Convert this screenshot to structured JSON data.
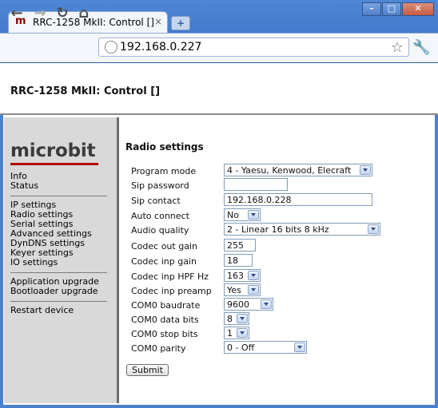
{
  "browser": {
    "tab_title": "RRC-1258 MkII: Control []",
    "tab_favicon": "m",
    "tab_close": "×",
    "new_tab": "+",
    "window_controls": {
      "min": "–",
      "max": "□",
      "close": "✕"
    },
    "nav": {
      "back": "←",
      "forward": "→",
      "reload": "↻",
      "home": "⌂"
    },
    "url": "192.168.0.227",
    "bookmark_star": "☆",
    "wrench": "🔧"
  },
  "page": {
    "heading": "RRC-1258 MkII: Control []"
  },
  "sidebar": {
    "logo": "microbit",
    "group1": [
      "Info",
      "Status"
    ],
    "group2": [
      "IP settings",
      "Radio settings",
      "Serial settings",
      "Advanced settings",
      "DynDNS settings",
      "Keyer settings",
      "IO settings"
    ],
    "group3": [
      "Application upgrade",
      "Bootloader upgrade"
    ],
    "group4": [
      "Restart device"
    ]
  },
  "form": {
    "title": "Radio settings",
    "rows": [
      {
        "label": "Program mode",
        "value": "4 - Yaesu, Kenwood, Elecraft"
      },
      {
        "label": "Sip password",
        "value": ""
      },
      {
        "label": "Sip contact",
        "value": "192.168.0.228"
      },
      {
        "label": "Auto connect",
        "value": "No"
      },
      {
        "label": "Audio quality",
        "value": "2 - Linear 16 bits 8 kHz"
      },
      {
        "label": "Codec out gain",
        "value": "255"
      },
      {
        "label": "Codec inp gain",
        "value": "18"
      },
      {
        "label": "Codec inp HPF Hz",
        "value": "163"
      },
      {
        "label": "Codec inp preamp",
        "value": "Yes"
      },
      {
        "label": "COM0 baudrate",
        "value": "9600"
      },
      {
        "label": "COM0 data bits",
        "value": "8"
      },
      {
        "label": "COM0 stop bits",
        "value": "1"
      },
      {
        "label": "COM0 parity",
        "value": "0 - Off"
      }
    ],
    "submit": "Submit"
  },
  "colors": {
    "brand_red": "#b20000",
    "chrome_blue": "#4a80d0",
    "sidebar_gray": "#d9d9d9"
  }
}
